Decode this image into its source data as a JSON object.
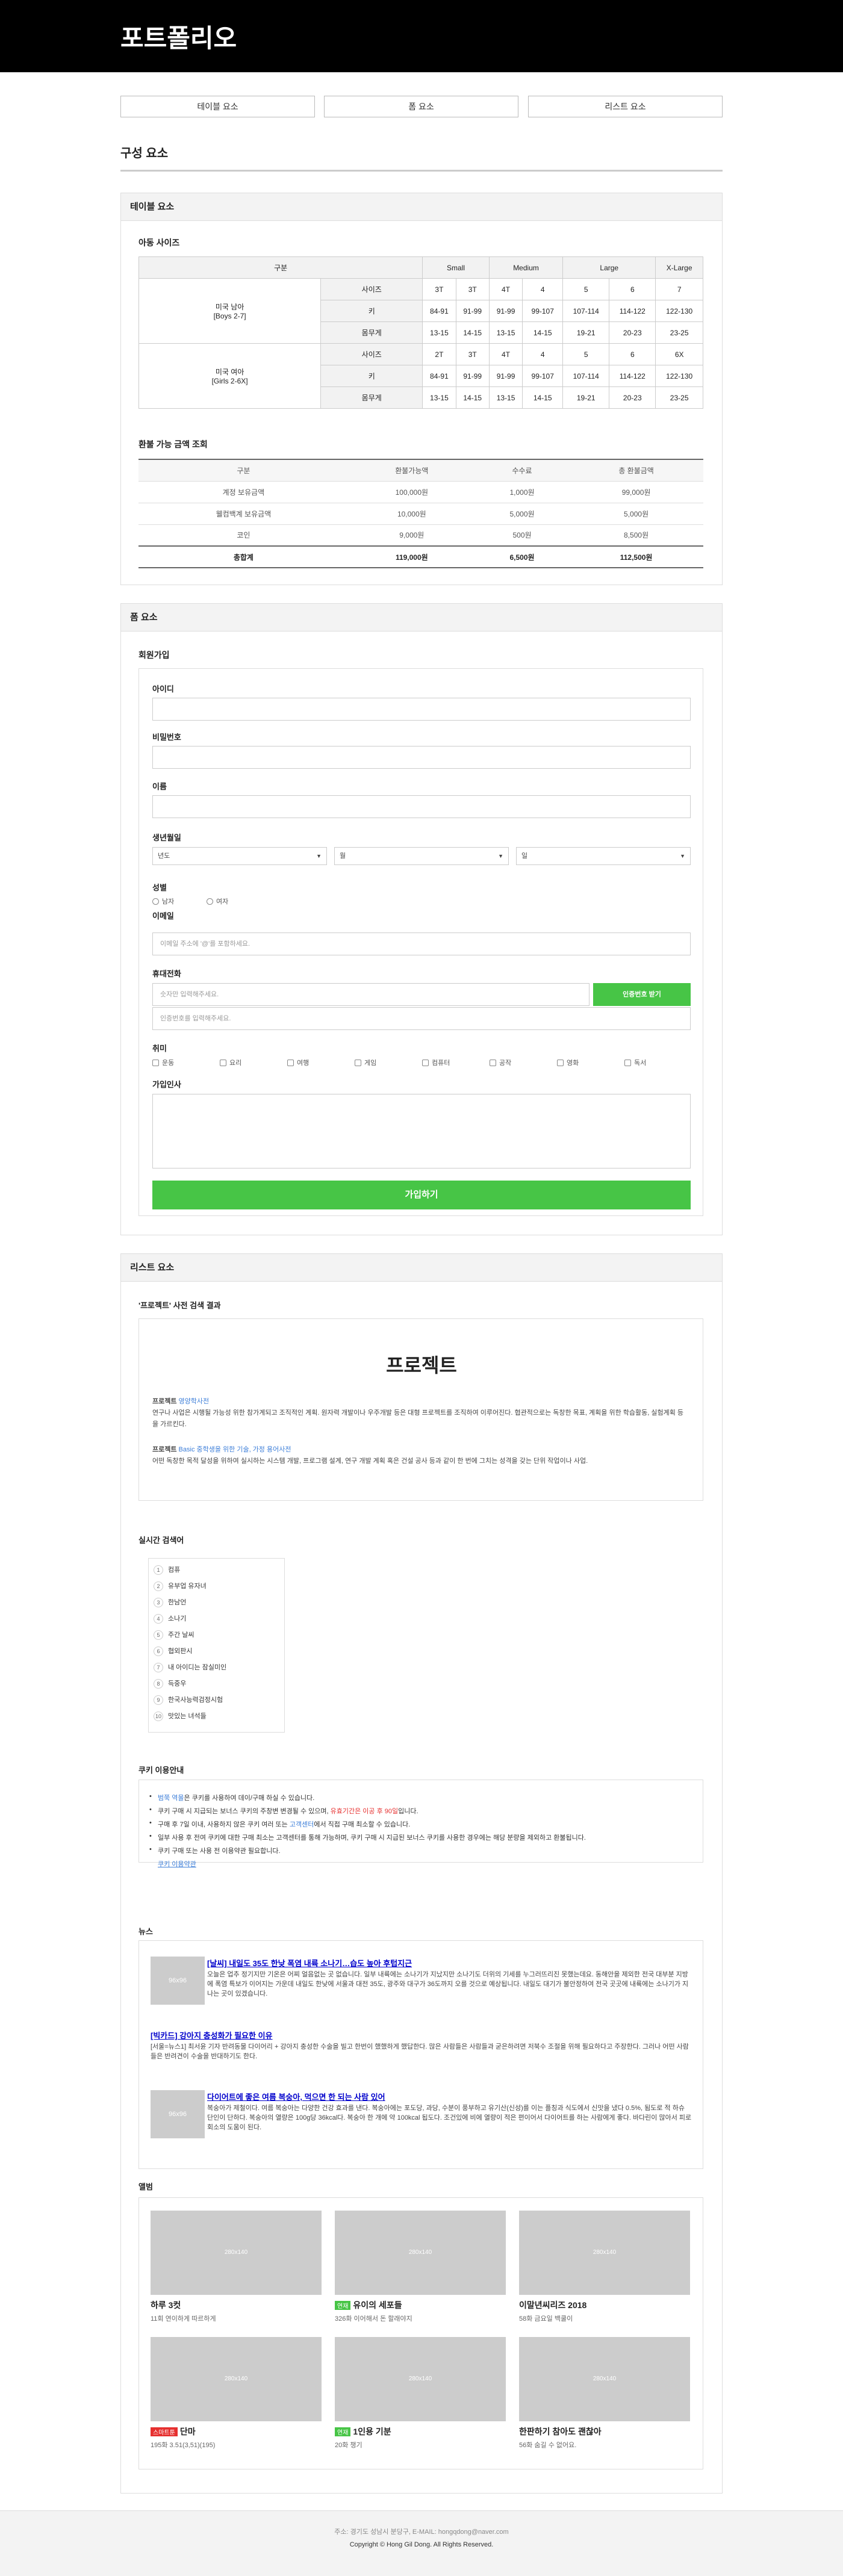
{
  "header": {
    "title": "포트폴리오"
  },
  "nav": [
    "테이블 요소",
    "폼 요소",
    "리스트 요소"
  ],
  "page_title": "구성 요소",
  "table_section": {
    "title": "테이블 요소",
    "size_title": "아동 사이즈",
    "size_table": {
      "corner": "구분",
      "sizes": [
        "Small",
        "Medium",
        "Large",
        "X-Large"
      ],
      "groups": [
        {
          "name": "미국 남아",
          "sub": "[Boys 2-7]",
          "rows": [
            {
              "label": "사이즈",
              "cells": [
                "3T",
                "3T",
                "4T",
                "4",
                "5",
                "6",
                "7"
              ]
            },
            {
              "label": "키",
              "cells": [
                "84-91",
                "91-99",
                "91-99",
                "99-107",
                "107-114",
                "114-122",
                "122-130"
              ]
            },
            {
              "label": "몸무게",
              "cells": [
                "13-15",
                "14-15",
                "13-15",
                "14-15",
                "19-21",
                "20-23",
                "23-25"
              ]
            }
          ]
        },
        {
          "name": "미국 여아",
          "sub": "[Girls 2-6X]",
          "rows": [
            {
              "label": "사이즈",
              "cells": [
                "2T",
                "3T",
                "4T",
                "4",
                "5",
                "6",
                "6X"
              ]
            },
            {
              "label": "키",
              "cells": [
                "84-91",
                "91-99",
                "91-99",
                "99-107",
                "107-114",
                "114-122",
                "122-130"
              ]
            },
            {
              "label": "몸무게",
              "cells": [
                "13-15",
                "14-15",
                "13-15",
                "14-15",
                "19-21",
                "20-23",
                "23-25"
              ]
            }
          ]
        }
      ]
    },
    "refund_title": "환불 가능 금액 조회",
    "refund_table": {
      "headers": [
        "구분",
        "환불가능액",
        "수수료",
        "총 환불금액"
      ],
      "rows": [
        [
          "계정 보유금액",
          "100,000원",
          "1,000원",
          "99,000원"
        ],
        [
          "웰컴백계 보유금액",
          "10,000원",
          "5,000원",
          "5,000원"
        ],
        [
          "코인",
          "9,000원",
          "500원",
          "8,500원"
        ]
      ],
      "total": [
        "총합계",
        "119,000원",
        "6,500원",
        "112,500원"
      ]
    }
  },
  "form_section": {
    "title": "폼 요소",
    "subtitle": "회원가입",
    "id_label": "아이디",
    "pw_label": "비밀번호",
    "name_label": "이름",
    "birth_label": "생년월일",
    "birth_selects": [
      "년도",
      "월",
      "일"
    ],
    "gender_label": "성별",
    "genders": [
      "남자",
      "여자"
    ],
    "email_label": "이메일",
    "email_placeholder": "이메일 주소에 '@'를 포함하세요.",
    "phone_label": "휴대전화",
    "phone_placeholder": "숫자만 입력해주세요.",
    "auth_button": "인증번호 받기",
    "auth_placeholder": "인증번호를 입력해주세요.",
    "hobby_label": "취미",
    "hobbies": [
      "운동",
      "요리",
      "여행",
      "게임",
      "컴퓨터",
      "공작",
      "영화",
      "독서"
    ],
    "greeting_label": "가입인사",
    "submit": "가입하기"
  },
  "list_section": {
    "title": "리스트 요소",
    "dict_title": "'프로젝트' 사전 검색 결과",
    "dict_word": "프로젝트",
    "dict_entries": [
      {
        "term": "프로젝트",
        "tag": "영양학사전",
        "text": "연구나 사업은 시행될 가능성 위한 참가계되고 조직적인 계획. 원자력 개발이나 우주개발 등은 대형 프로젝트를 조직하여 이루어진다. 협관적으로는 독창한 목표, 계획을 위한 학습활동, 실험계획 등을 가르킨다."
      },
      {
        "term": "프로젝트",
        "tag": "Basic 중학생을 위한 기술, 가정 용어사전",
        "text": "어떤 독창한 목적 달성을 위하여 실시하는 시스템 개발, 프로그램 설계, 연구 개발 계획 혹은 건설 공사 등과 같이 한 번에 그치는 성격을 갖는 단위 작업이나 사업."
      }
    ],
    "rank_title": "실시간 검색어",
    "ranks": [
      "컴퓨",
      "유부업 유자녀",
      "한남언",
      "소나기",
      "주간 날씨",
      "협외판시",
      "내 아이디는 잠실미인",
      "득중우",
      "한국사능력검정시험",
      "맛있는 녀석들"
    ],
    "cookie_title": "쿠키 이용안내",
    "cookie_items": [
      {
        "pre": "",
        "link": "범쭉 역몰",
        "post": "은 쿠키를 사용하여 데이/구매 하실 수 있습니다."
      },
      {
        "pre": "쿠키 구매 시 지급되는 보너스 쿠키의 주창변 변경될 수 있으며, ",
        "red": "유효기간은 이공 후 90일",
        "post": "입니다."
      },
      {
        "pre": "구매 후 7일 이내, 사용하지 않은 쿠키 여러 또는 ",
        "link": "고객센터",
        "post": "에서 직접 구매 최소할 수 있습니다."
      },
      {
        "pre": "일부 사용 후 전여 쿠키에 대한 구매 최소는 고객센터를 통해 가능하며, 쿠키 구매 시 지급된 보너스 쿠키를 사용한 경우에는 해당 분량을 제외하고 환불됩니다.",
        "post": ""
      },
      {
        "pre": "쿠키 구매 또는 사용 전 이용약관 필요합니다.",
        "post": ""
      }
    ],
    "cookie_more": "쿠키 이용약관",
    "news_title": "뉴스",
    "news": [
      {
        "title": "[날씨] 내일도 35도 한낮 폭염 내륙 소나기…습도 높아 후텁지근",
        "text": "오늘은 업추 정기지만 기온은 어찌 얼음없는 곳 없습니다. 일부 내륙에는 소나기가 지났지만 소나기도 더위의 기세를 누그러뜨리진 못했는데요. 동해안을 제외한 전국 대부분 지방에 폭염 특보가 이어지는 가운데 내일도 한낮에 서울과 대전 35도, 광주와 대구가 36도까지 오를 것으로 예상됩니다. 내일도 대기가 불안정하여 전국 곳곳에 내륙에는 소나기가 지나는 곳이 있겠습니다.",
        "thumb": "96x96"
      },
      {
        "title": "[빅카드] 강아지 충성화가 필요한 이유",
        "text": "[서울=뉴스1] 최서윤 기자 반려동물 다이어리 + 강아지 충성한 수술을 빌고 한번이 했했하게 했답한다. 많은 사람들은 사람들과 굳은하려면 저북수 조절을 위해 필요하다고 주장한다. 그러나 어떤 사람들은 반려견이 수술을 반대하기도 한다.",
        "thumb": ""
      },
      {
        "title": "다이어트에 좋은 여름 복숭아, 먹으면 한 되는 사람 있어",
        "text": "복숭아가 제철이다. 여름 복숭아는 다양한 건강 효과를 낸다. 복숭아에는 포도당, 과당, 수분이 풍부하고 유기산(신성)를 이는 플칭과 식도에서 신맛을 냈다 0.5%, 됨도로 적 하슈 단인이 단하다. 복숭아의 열량은 100g당 36kcal다. 복숭아 한 개에 약 100kcal 됩도다. 조건있에 비에 열량이 적은 편이어서 다이어트를 하는 사람에게 좋다. 바다린이 많아서 피로 회소의 도움이 된다.",
        "thumb": "96x96"
      }
    ],
    "album_title": "앨범",
    "albums": [
      {
        "thumb": "280x140",
        "title": "하루 3컷",
        "tag": "",
        "tag_color": "",
        "sub": "11회 연이하게 따르하게"
      },
      {
        "thumb": "280x140",
        "title": "유이의 세포들",
        "tag": "연재",
        "tag_color": "#47c546",
        "sub": "326화 이어해서 돈 할래야지"
      },
      {
        "thumb": "280x140",
        "title": "이말년씨리즈 2018",
        "tag": "",
        "tag_color": "",
        "sub": "58화 금요일 백쿨이"
      },
      {
        "thumb": "280x140",
        "title": "단마",
        "tag": "스마트툰",
        "tag_color": "#e6302f",
        "sub": "195화 3.51(3,51)(195)"
      },
      {
        "thumb": "280x140",
        "title": "1인용 기분",
        "tag": "연재",
        "tag_color": "#47c546",
        "sub": "20화 챙기"
      },
      {
        "thumb": "280x140",
        "title": "한판하기 참아도 괜찮아",
        "tag": "",
        "tag_color": "",
        "sub": "56화 숨길 수 없어요."
      }
    ]
  },
  "footer": {
    "address": "주소: 경기도 성남시 분당구, E-MAIL: hongqdong@naver.com",
    "copyright": "Copyright © Hong Gil Dong. All Rights Reserved."
  }
}
